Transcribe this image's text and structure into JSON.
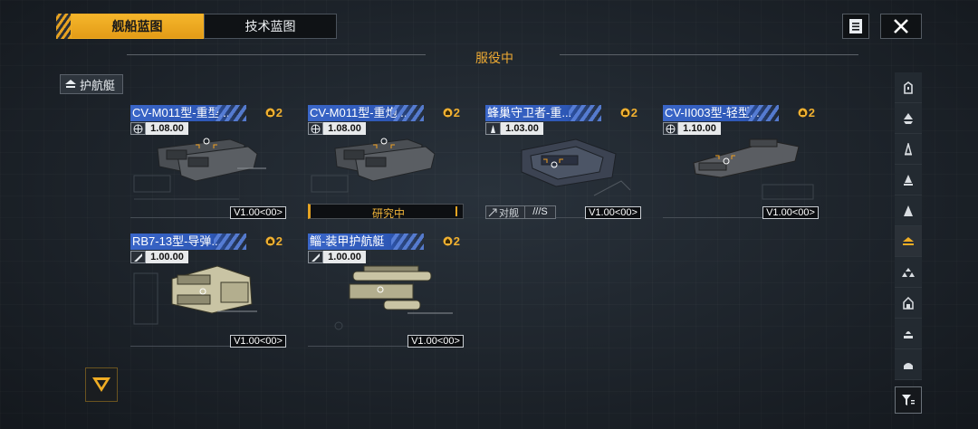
{
  "tabs": [
    {
      "label": "舰船蓝图",
      "active": true
    },
    {
      "label": "技术蓝图",
      "active": false
    }
  ],
  "header": {
    "status": "服役中"
  },
  "category": {
    "label": "护航艇"
  },
  "cards": [
    {
      "name": "CV-M011型-重型...",
      "tier": "2",
      "version": "1.08.00",
      "type_icon": "globe-icon",
      "label": "V1.00<00>",
      "research": null,
      "role": null,
      "grade": null
    },
    {
      "name": "CV-M011型-重炮...",
      "tier": "2",
      "version": "1.08.00",
      "type_icon": "globe-icon",
      "label": null,
      "research": "研究中",
      "role": null,
      "grade": null
    },
    {
      "name": "蜂巢守卫者-重...",
      "tier": "2",
      "version": "1.03.00",
      "type_icon": "tower-icon",
      "label": "V1.00<00>",
      "research": null,
      "role": "对舰",
      "grade": "///S"
    },
    {
      "name": "CV-II003型-轻型...",
      "tier": "2",
      "version": "1.10.00",
      "type_icon": "globe-icon",
      "label": "V1.00<00>",
      "research": null,
      "role": null,
      "grade": null
    },
    {
      "name": "RB7-13型-导弹...",
      "tier": "2",
      "version": "1.00.00",
      "type_icon": "wing-icon",
      "label": "V1.00<00>",
      "research": null,
      "role": null,
      "grade": null
    },
    {
      "name": "鲻-装甲护航艇",
      "tier": "2",
      "version": "1.00.00",
      "type_icon": "wing-icon",
      "label": "V1.00<00>",
      "research": null,
      "role": null,
      "grade": null
    }
  ],
  "sidebar": {
    "items": [
      "ship-class-1-icon",
      "ship-class-2-icon",
      "ship-class-3-icon",
      "ship-class-4-icon",
      "ship-class-5-icon",
      "escort-icon",
      "cluster-icon",
      "station-icon",
      "carrier-icon",
      "dome-icon"
    ],
    "active_index": 5
  },
  "colors": {
    "accent": "#f0ad24",
    "name_bar": "#2d57b6",
    "background": "#1f262e"
  }
}
